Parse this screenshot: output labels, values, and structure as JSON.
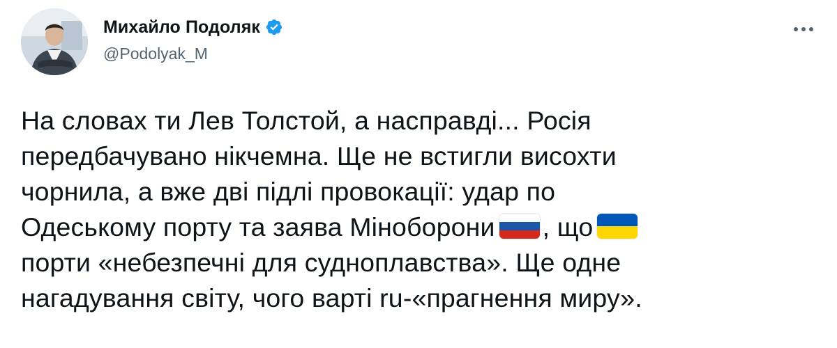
{
  "author": {
    "display_name": "Михайло Подоляк",
    "handle": "@Podolyak_M",
    "verified": true
  },
  "icons": {
    "verified": "verified-badge-icon",
    "more": "more-options-icon",
    "flag_russia": "russia-flag-icon",
    "flag_ukraine": "ukraine-flag-icon"
  },
  "colors": {
    "verified_blue": "#1d9bf0",
    "text_primary": "#0f1419",
    "text_secondary": "#536471",
    "flag_ru": [
      "#ffffff",
      "#1c57a7",
      "#d52b1e"
    ],
    "flag_ua": [
      "#0057b7",
      "#ffd700"
    ]
  },
  "tweet": {
    "line1": "На словах ти Лев Толстой, а насправді... Росія",
    "line2": "передбачувано нікчемна. Ще не встигли висохти",
    "line3": "чорнила, а вже дві підлі провокації: удар по",
    "line4_before_flag": "Одеському порту та заява Міноборони",
    "line4_middle": ", що",
    "line5": "порти «небезпечні для судноплавства». Ще одне",
    "line6": "нагадування світу, чого варті ru-«прагнення миру»."
  }
}
